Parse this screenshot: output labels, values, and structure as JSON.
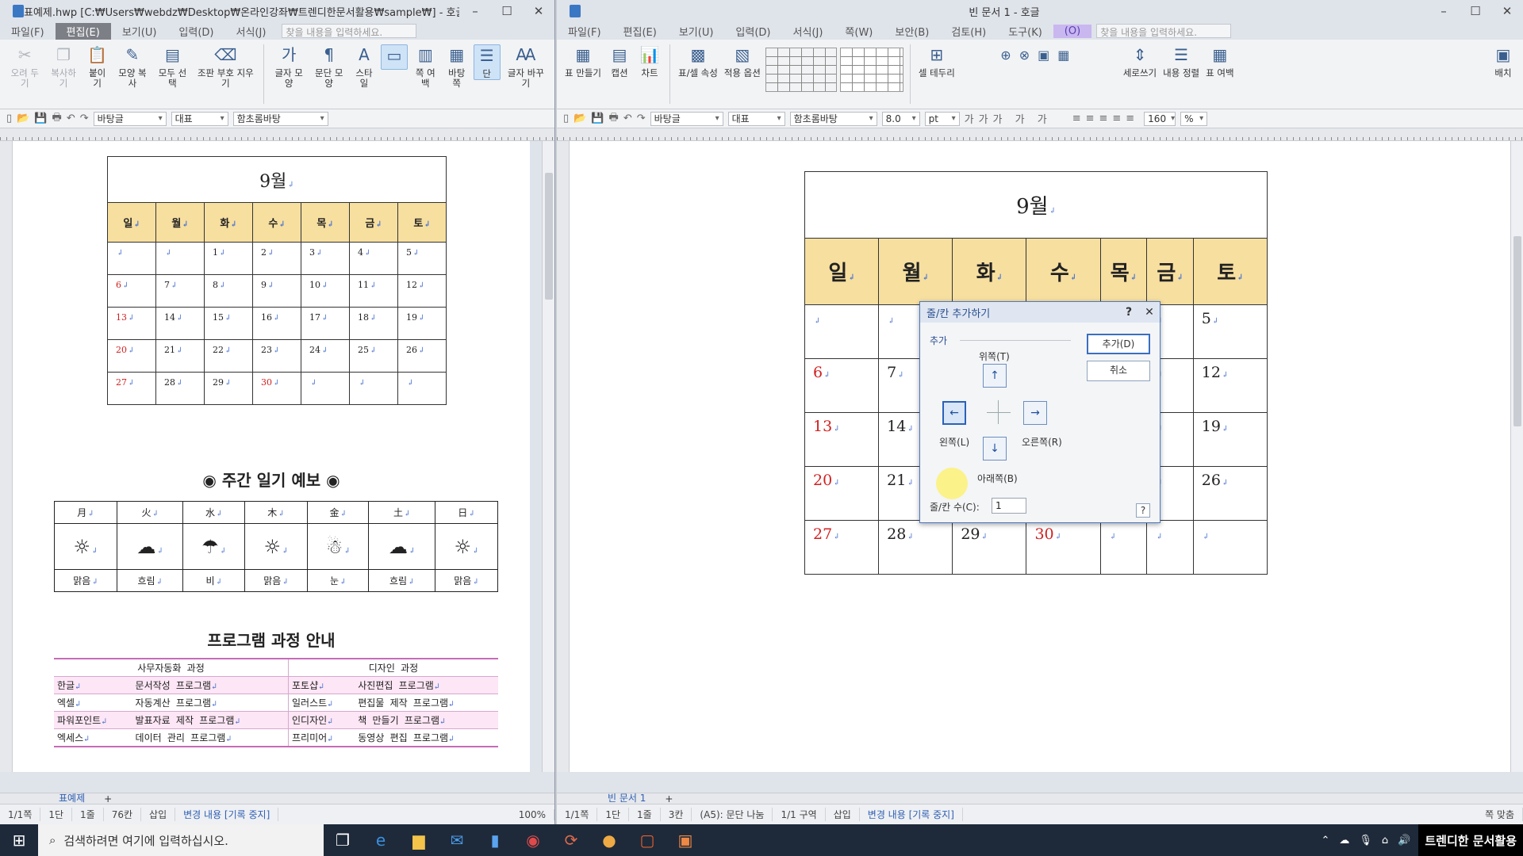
{
  "left_window": {
    "title": "표예제.hwp [C:₩Users₩webdz₩Desktop₩온라인강좌₩트렌디한문서활용₩sample₩] - 호글",
    "menu": [
      "파일(F)",
      "편집(E)",
      "보기(U)",
      "입력(D)",
      "서식(J)"
    ],
    "active_menu": "편집(E)",
    "search_placeholder": "찾을 내용을 입력하세요.",
    "ribbon": [
      "오려 두기",
      "복사하기",
      "붙이기",
      "모양 복사",
      "모두 선택",
      "조판 부호 지우기",
      "글자 모양",
      "문단 모양",
      "스타일",
      "",
      "쪽 여백",
      "바탕쪽",
      "단",
      "글자 바꾸기"
    ],
    "fmt": {
      "style": "바탕글",
      "font_class": "대표",
      "font": "함초롬바탕"
    },
    "calendar": {
      "title": "9월",
      "days": [
        "일",
        "월",
        "화",
        "수",
        "목",
        "금",
        "토"
      ],
      "rows": [
        [
          "",
          "",
          "1",
          "2",
          "3",
          "4",
          "5"
        ],
        [
          "6",
          "7",
          "8",
          "9",
          "10",
          "11",
          "12"
        ],
        [
          "13",
          "14",
          "15",
          "16",
          "17",
          "18",
          "19"
        ],
        [
          "20",
          "21",
          "22",
          "23",
          "24",
          "25",
          "26"
        ],
        [
          "27",
          "28",
          "29",
          "30",
          "",
          "",
          ""
        ]
      ]
    },
    "weather": {
      "title": "◉ 주간 일기 예보 ◉",
      "days": [
        "月",
        "火",
        "水",
        "木",
        "金",
        "土",
        "日"
      ],
      "icons": [
        "☼",
        "☁",
        "☂",
        "☼",
        "☃",
        "☁",
        "☼"
      ],
      "labels": [
        "맑음",
        "흐림",
        "비",
        "맑음",
        "눈",
        "흐림",
        "맑음"
      ]
    },
    "program": {
      "title": "프로그램 과정 안내",
      "headers": [
        "사무자동화 과정",
        "디자인 과정"
      ],
      "rows": [
        [
          "한글",
          "문서작성 프로그램",
          "포토샵",
          "사진편집 프로그램"
        ],
        [
          "엑셀",
          "자동계산 프로그램",
          "일러스트",
          "편집물 제작 프로그램"
        ],
        [
          "파워포인트",
          "발표자료 제작 프로그램",
          "인디자인",
          "책 만들기 프로그램"
        ],
        [
          "엑세스",
          "데이터 관리 프로그램",
          "프리미어",
          "동영상 편집 프로그램"
        ]
      ]
    },
    "sheet_tab": "표예제",
    "status": [
      "1/1쪽",
      "1단",
      "1줄",
      "76칸",
      "삽입",
      "변경 내용 [기록 중지]"
    ],
    "zoom": "100%"
  },
  "right_window": {
    "title": "빈 문서 1 - 호글",
    "menu": [
      "파일(F)",
      "편집(E)",
      "보기(U)",
      "입력(D)",
      "서식(J)",
      "쪽(W)",
      "보안(B)",
      "검토(H)",
      "도구(K)"
    ],
    "active_menu": "(O)",
    "search_placeholder": "찾을 내용을 입력하세요.",
    "ribbon": [
      "표 만들기",
      "캡션",
      "차트",
      "표/셀 속성",
      "적용 옵션",
      "셀 테두리",
      "세로쓰기",
      "내용 정렬",
      "표 여백",
      "배치"
    ],
    "fmt": {
      "style": "바탕글",
      "font_class": "대표",
      "font": "함초롬바탕",
      "size": "8.0",
      "unit": "pt",
      "zoom": "160",
      "zoom_unit": "%"
    },
    "calendar": {
      "title": "9월",
      "days": [
        "일",
        "월",
        "화",
        "수",
        "목",
        "금",
        "토"
      ],
      "rows": [
        [
          "",
          "",
          "",
          "",
          "",
          "",
          "5"
        ],
        [
          "6",
          "7",
          "",
          "",
          "",
          "",
          "12"
        ],
        [
          "13",
          "14",
          "",
          "",
          "",
          "",
          "19"
        ],
        [
          "20",
          "21",
          "",
          "",
          "",
          "",
          "26"
        ],
        [
          "27",
          "28",
          "29",
          "30",
          "",
          "",
          ""
        ]
      ]
    },
    "sheet_tab": "빈 문서 1",
    "status": [
      "1/1쪽",
      "1단",
      "1줄",
      "3칸",
      "(A5): 문단 나눔",
      "1/1 구역",
      "삽입",
      "변경 내용 [기록 중지]"
    ],
    "fit_label": "쪽 맞춤"
  },
  "dialog": {
    "title": "줄/칸 추가하기",
    "group": "추가",
    "top": "위쪽(T)",
    "left": "왼쪽(L)",
    "right": "오른쪽(R)",
    "bottom": "아래쪽(B)",
    "count_label": "줄/칸 수(C):",
    "count_value": "1",
    "ok": "추가(D)",
    "cancel": "취소",
    "help": "?"
  },
  "taskbar": {
    "search_placeholder": "검색하려면 여기에 입력하십시오.",
    "brand": "트렌디한 문서활용"
  }
}
